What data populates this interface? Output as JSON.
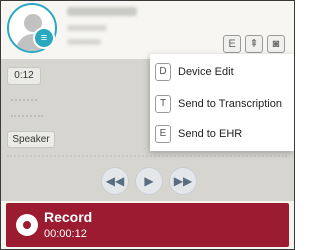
{
  "header": {
    "icons": [
      "E",
      "pin-icon",
      "camera-icon"
    ]
  },
  "player": {
    "time": "0:12",
    "speaker_label": "Speaker"
  },
  "menu": {
    "items": [
      {
        "key": "D",
        "label": "Device Edit"
      },
      {
        "key": "T",
        "label": "Send to Transcription"
      },
      {
        "key": "E",
        "label": "Send to EHR"
      }
    ]
  },
  "record": {
    "title": "Record",
    "elapsed": "00:00:12"
  },
  "colors": {
    "accent": "#2aa8c0",
    "record_bar": "#9b1b30"
  }
}
